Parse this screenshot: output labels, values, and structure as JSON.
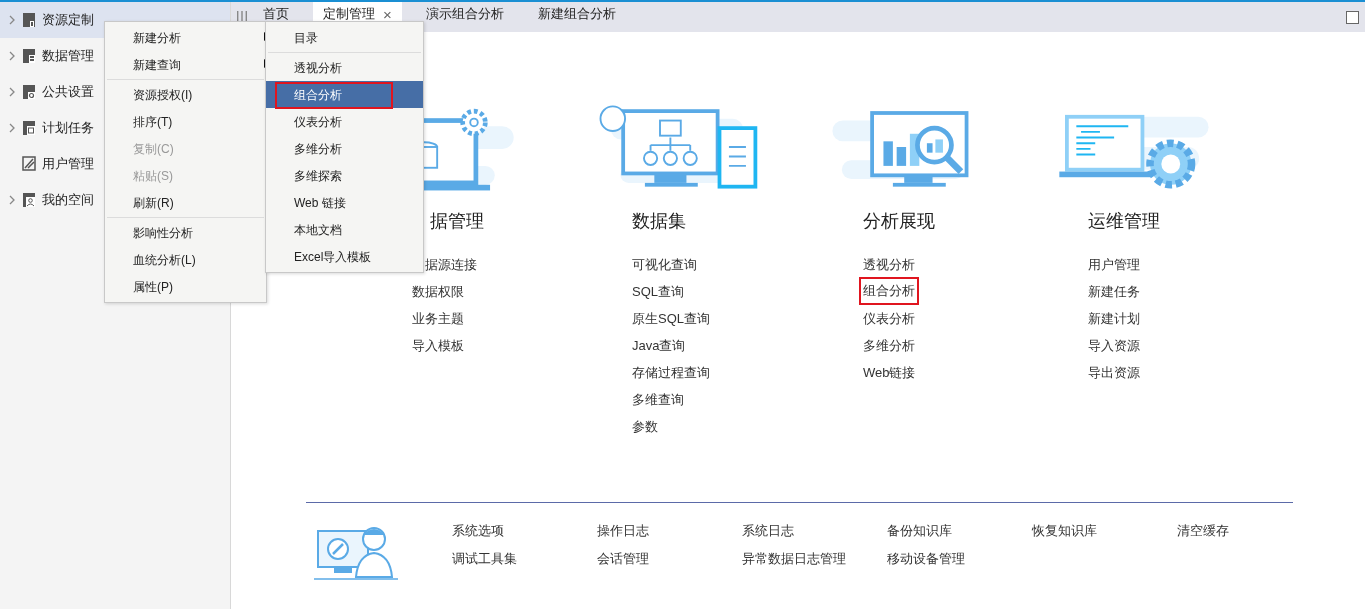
{
  "sidebar": {
    "items": [
      {
        "label": "资源定制",
        "expandable": true,
        "selected": true
      },
      {
        "label": "数据管理",
        "expandable": true,
        "selected": false
      },
      {
        "label": "公共设置",
        "expandable": true,
        "selected": false
      },
      {
        "label": "计划任务",
        "expandable": true,
        "selected": false
      },
      {
        "label": "用户管理",
        "expandable": false,
        "selected": false
      },
      {
        "label": "我的空间",
        "expandable": true,
        "selected": false
      }
    ]
  },
  "tabs": [
    {
      "label": "首页",
      "selected": false,
      "closable": false
    },
    {
      "label": "定制管理",
      "selected": true,
      "closable": true,
      "close": "×"
    },
    {
      "label": "演示组合分析",
      "selected": false,
      "closable": false
    },
    {
      "label": "新建组合分析",
      "selected": false,
      "closable": false
    }
  ],
  "context_menu": {
    "groups": [
      [
        {
          "label": "新建分析",
          "disabled": false,
          "has_submenu": true
        },
        {
          "label": "新建查询",
          "disabled": false,
          "has_submenu": true
        }
      ],
      [
        {
          "label": "资源授权(I)",
          "disabled": false,
          "has_submenu": false
        },
        {
          "label": "排序(T)",
          "disabled": false,
          "has_submenu": false
        },
        {
          "label": "复制(C)",
          "disabled": true,
          "has_submenu": false
        },
        {
          "label": "粘贴(S)",
          "disabled": true,
          "has_submenu": false
        },
        {
          "label": "刷新(R)",
          "disabled": false,
          "has_submenu": false
        }
      ],
      [
        {
          "label": "影响性分析",
          "disabled": false,
          "has_submenu": false
        },
        {
          "label": "血统分析(L)",
          "disabled": false,
          "has_submenu": false
        },
        {
          "label": "属性(P)",
          "disabled": false,
          "has_submenu": false
        }
      ]
    ]
  },
  "submenu": {
    "groups": [
      [
        {
          "label": "目录",
          "selected": false,
          "highlighted": false
        }
      ],
      [
        {
          "label": "透视分析",
          "selected": false,
          "highlighted": false
        },
        {
          "label": "组合分析",
          "selected": true,
          "highlighted": true
        },
        {
          "label": "仪表分析",
          "selected": false,
          "highlighted": false
        },
        {
          "label": "多维分析",
          "selected": false,
          "highlighted": false
        },
        {
          "label": "多维探索",
          "selected": false,
          "highlighted": false
        },
        {
          "label": "Web 链接",
          "selected": false,
          "highlighted": false
        },
        {
          "label": "本地文档",
          "selected": false,
          "highlighted": false
        },
        {
          "label": "Excel导入模板",
          "selected": false,
          "highlighted": false
        }
      ]
    ]
  },
  "sections": [
    {
      "title": "据管理",
      "links": [
        {
          "label": "据源连接",
          "highlighted": false
        },
        {
          "label": "数据权限",
          "highlighted": false
        },
        {
          "label": "业务主题",
          "highlighted": false
        },
        {
          "label": "导入模板",
          "highlighted": false
        }
      ]
    },
    {
      "title": "数据集",
      "links": [
        {
          "label": "可视化查询",
          "highlighted": false
        },
        {
          "label": "SQL查询",
          "highlighted": false
        },
        {
          "label": "原生SQL查询",
          "highlighted": false
        },
        {
          "label": "Java查询",
          "highlighted": false
        },
        {
          "label": "存储过程查询",
          "highlighted": false
        },
        {
          "label": "多维查询",
          "highlighted": false
        },
        {
          "label": "参数",
          "highlighted": false
        }
      ]
    },
    {
      "title": "分析展现",
      "links": [
        {
          "label": "透视分析",
          "highlighted": false
        },
        {
          "label": "组合分析",
          "highlighted": true
        },
        {
          "label": "仪表分析",
          "highlighted": false
        },
        {
          "label": "多维分析",
          "highlighted": false
        },
        {
          "label": "Web链接",
          "highlighted": false
        }
      ]
    },
    {
      "title": "运维管理",
      "links": [
        {
          "label": "用户管理",
          "highlighted": false
        },
        {
          "label": "新建任务",
          "highlighted": false
        },
        {
          "label": "新建计划",
          "highlighted": false
        },
        {
          "label": "导入资源",
          "highlighted": false
        },
        {
          "label": "导出资源",
          "highlighted": false
        }
      ]
    }
  ],
  "footer": {
    "links": [
      "系统选项",
      "操作日志",
      "系统日志",
      "备份知识库",
      "恢复知识库",
      "清空缓存",
      "调试工具集",
      "会话管理",
      "异常数据日志管理",
      "移动设备管理"
    ]
  }
}
